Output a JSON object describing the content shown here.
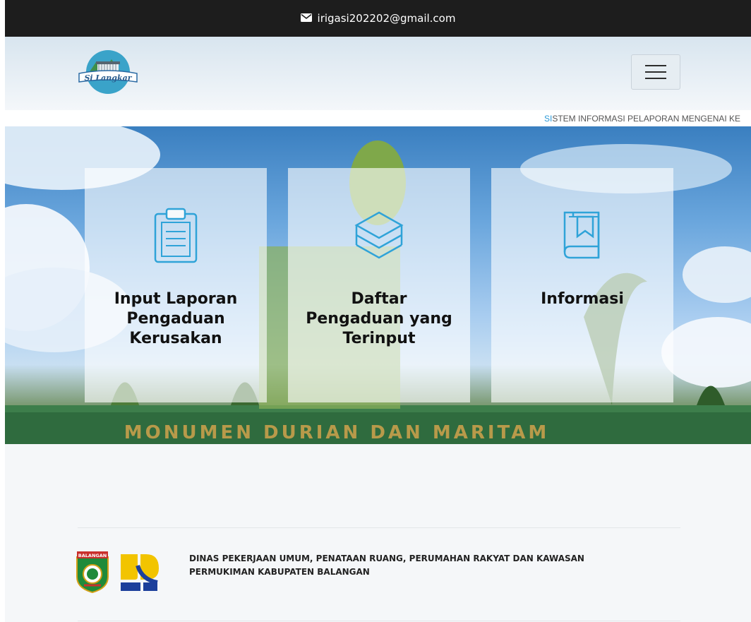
{
  "topbar": {
    "email": "irigasi202202@gmail.com",
    "icon": "envelope-icon"
  },
  "header": {
    "logo_text": "Si Langkar",
    "menu_icon": "hamburger-icon"
  },
  "marquee": {
    "first_letters": "SI",
    "rest": "STEM INFORMASI PELAPORAN MENGENAI KE"
  },
  "hero": {
    "banner_text": "MONUMEN DURIAN DAN MARITAM",
    "cards": [
      {
        "label": "Input Laporan Pengaduan Kerusakan",
        "icon": "clipboard-icon"
      },
      {
        "label": "Daftar Pengaduan yang Terinput",
        "icon": "layers-icon"
      },
      {
        "label": "Informasi",
        "icon": "book-icon"
      }
    ]
  },
  "footer": {
    "agency": "DINAS PEKERJAAN UMUM, PENATAAN RUANG, PERUMAHAN RAKYAT DAN KAWASAN PERMUKIMAN KABUPATEN BALANGAN",
    "badge_text": "BALANGAN"
  },
  "colors": {
    "accent": "#2d9ad8",
    "topbar": "#1d1d1d",
    "page_bg": "#f5f7f9"
  }
}
